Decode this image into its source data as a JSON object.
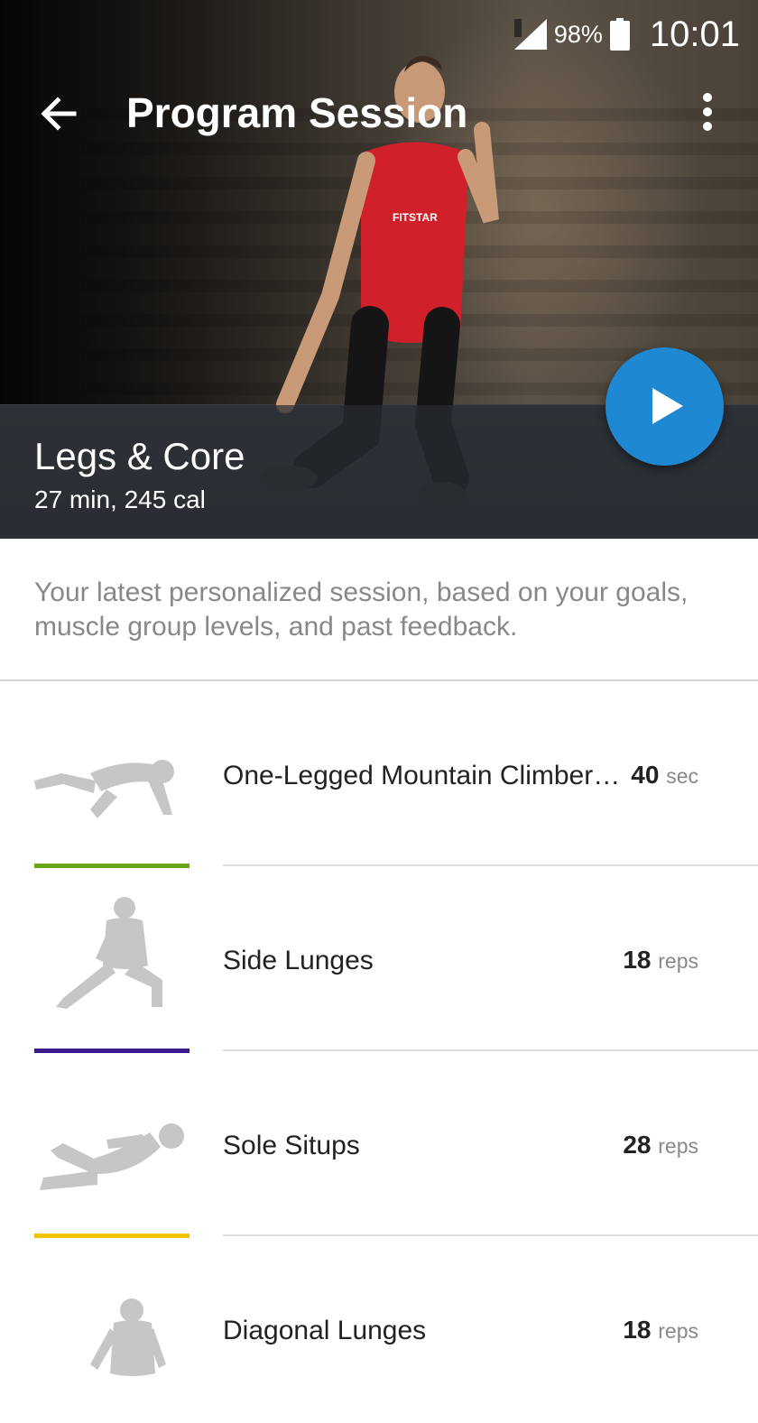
{
  "status_bar": {
    "battery": "98%",
    "time": "10:01"
  },
  "app_bar": {
    "title": "Program Session"
  },
  "hero": {
    "shirt_text": "FITSTAR"
  },
  "session": {
    "title": "Legs & Core",
    "meta": "27 min, 245 cal"
  },
  "description": "Your latest personalized session, based on your goals, muscle group levels, and past feedback.",
  "exercises": [
    {
      "name": "One-Legged Mountain Climber…",
      "amount": "40",
      "unit": "sec",
      "accent": "#6aa514",
      "icon": "mountain-climber-figure-icon"
    },
    {
      "name": "Side Lunges",
      "amount": "18",
      "unit": "reps",
      "accent": "#3b1a8c",
      "icon": "side-lunge-figure-icon"
    },
    {
      "name": "Sole Situps",
      "amount": "28",
      "unit": "reps",
      "accent": "#f2c300",
      "icon": "situp-figure-icon"
    },
    {
      "name": "Diagonal Lunges",
      "amount": "18",
      "unit": "reps",
      "accent": "#cccccc",
      "icon": "lunge-figure-icon"
    }
  ],
  "colors": {
    "fab": "#1e88d3",
    "description_text": "#888888"
  }
}
